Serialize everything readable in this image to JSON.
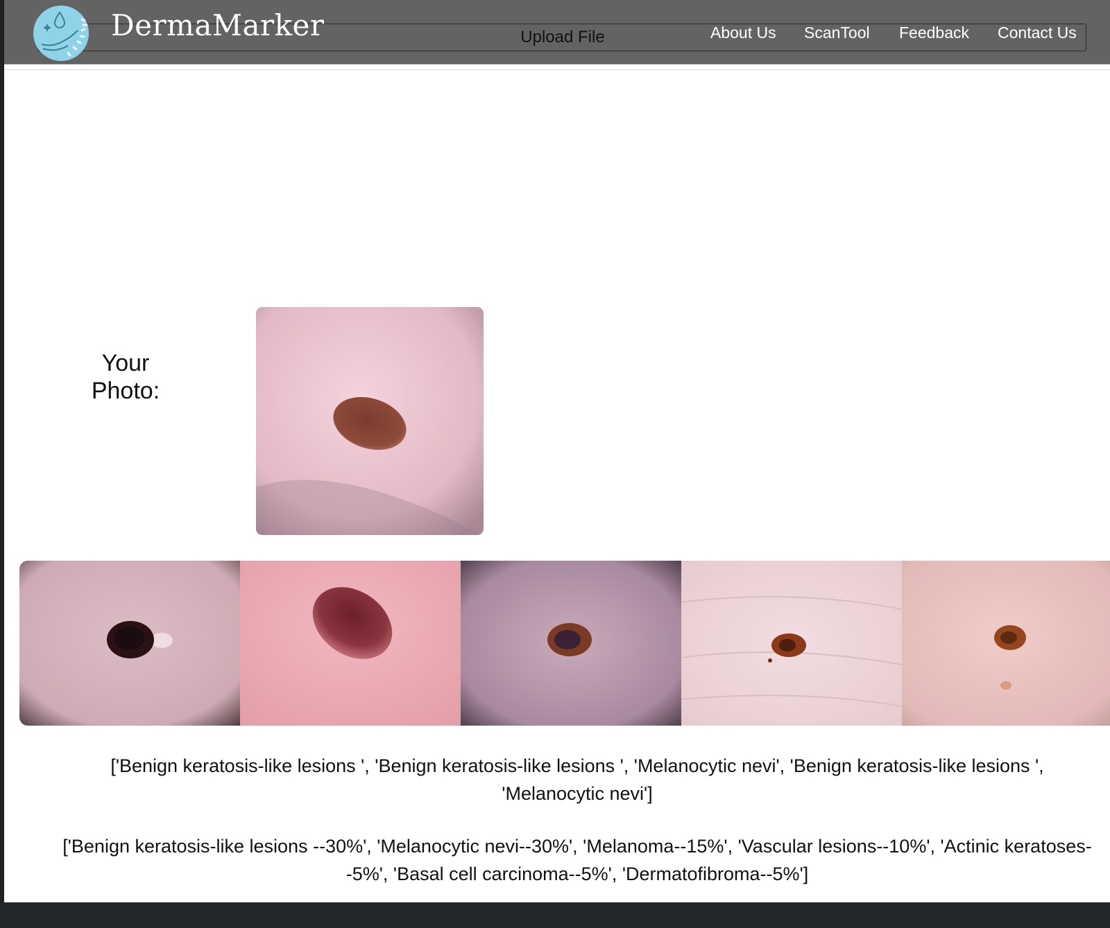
{
  "brand": {
    "name": "DermaMarker",
    "logo_icon": "hand-with-water-drop-icon"
  },
  "upload": {
    "label": "Upload File"
  },
  "nav": {
    "items": [
      {
        "label": "About Us"
      },
      {
        "label": "ScanTool"
      },
      {
        "label": "Feedback"
      },
      {
        "label": "Contact Us"
      }
    ]
  },
  "result": {
    "your_photo_label_line1": "Your",
    "your_photo_label_line2": "Photo:",
    "similar_images_count": 5,
    "similar_labels_text": "['Benign keratosis-like lesions ', 'Benign keratosis-like lesions ', 'Melanocytic nevi', 'Benign keratosis-like lesions ', 'Melanocytic nevi']",
    "probabilities_text": "['Benign keratosis-like lesions --30%', 'Melanocytic nevi--30%', 'Melanoma--15%', 'Vascular lesions--10%', 'Actinic keratoses--5%', 'Basal cell carcinoma--5%', 'Dermatofibroma--5%']"
  },
  "colors": {
    "navbar_bg": "#636363",
    "logo_circle": "#8fd3e8",
    "page_bg": "#ffffff",
    "bottom_bar": "#23262b"
  }
}
